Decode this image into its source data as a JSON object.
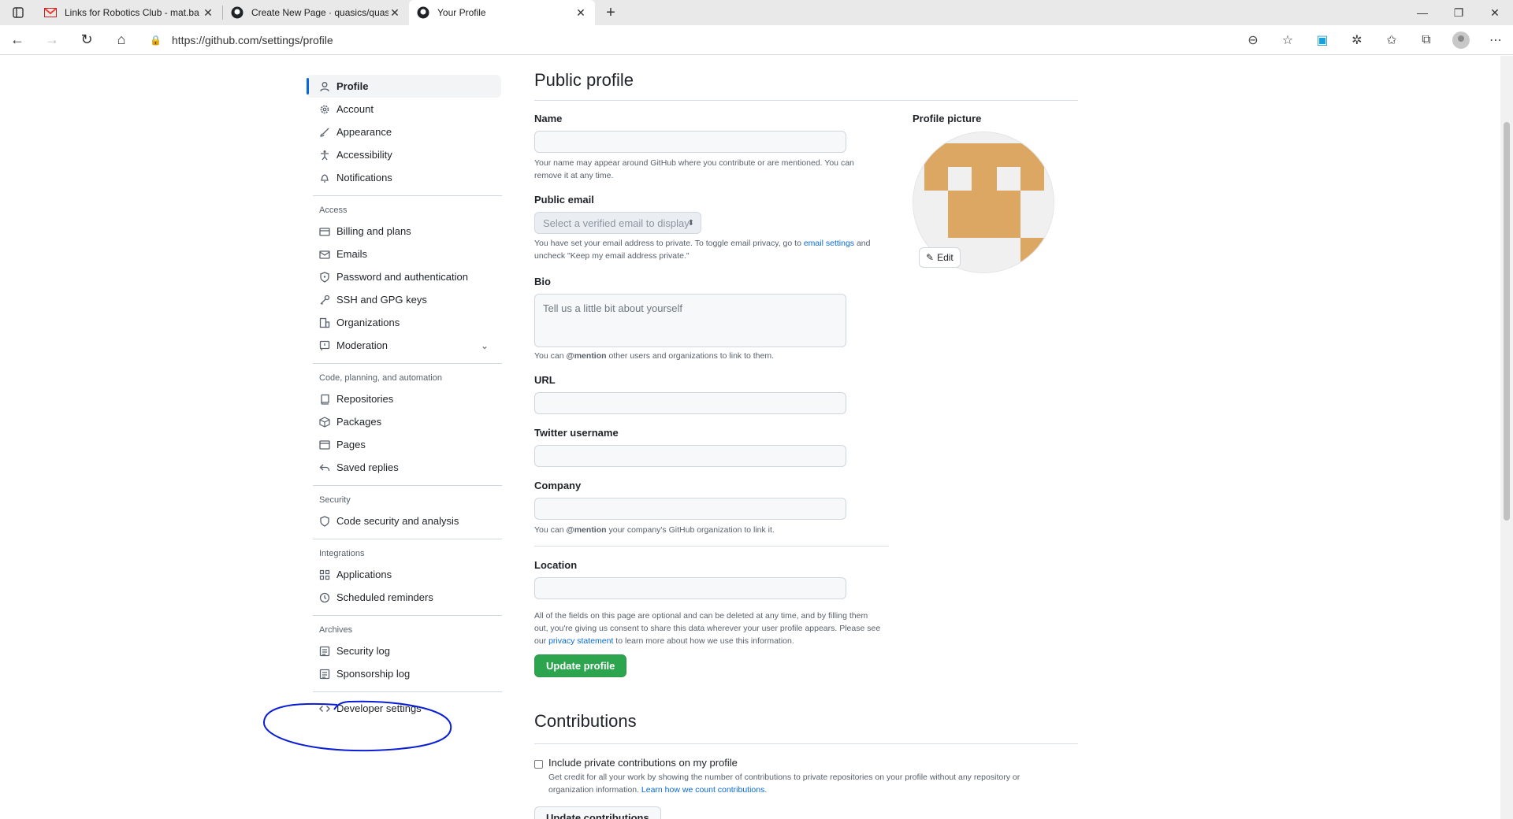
{
  "browser": {
    "tabs": [
      {
        "title": "Links for Robotics Club - mat.ba",
        "favicon": "gmail-icon",
        "active": false
      },
      {
        "title": "Create New Page · quasics/quasi",
        "favicon": "github-icon",
        "active": false
      },
      {
        "title": "Your Profile",
        "favicon": "github-icon",
        "active": true
      }
    ],
    "url": "https://github.com/settings/profile"
  },
  "sidebar": {
    "top": [
      {
        "label": "Profile",
        "icon": "person-icon",
        "selected": true
      },
      {
        "label": "Account",
        "icon": "gear-icon"
      },
      {
        "label": "Appearance",
        "icon": "paintbrush-icon"
      },
      {
        "label": "Accessibility",
        "icon": "accessibility-icon"
      },
      {
        "label": "Notifications",
        "icon": "bell-icon"
      }
    ],
    "access_heading": "Access",
    "access": [
      {
        "label": "Billing and plans",
        "icon": "credit-card-icon"
      },
      {
        "label": "Emails",
        "icon": "mail-icon"
      },
      {
        "label": "Password and authentication",
        "icon": "shield-lock-icon"
      },
      {
        "label": "SSH and GPG keys",
        "icon": "key-icon"
      },
      {
        "label": "Organizations",
        "icon": "organization-icon"
      },
      {
        "label": "Moderation",
        "icon": "report-icon"
      }
    ],
    "code_heading": "Code, planning, and automation",
    "code": [
      {
        "label": "Repositories",
        "icon": "repo-icon"
      },
      {
        "label": "Packages",
        "icon": "package-icon"
      },
      {
        "label": "Pages",
        "icon": "browser-icon"
      },
      {
        "label": "Saved replies",
        "icon": "reply-icon"
      }
    ],
    "security_heading": "Security",
    "security": [
      {
        "label": "Code security and analysis",
        "icon": "shield-icon"
      }
    ],
    "integrations_heading": "Integrations",
    "integrations": [
      {
        "label": "Applications",
        "icon": "apps-icon"
      },
      {
        "label": "Scheduled reminders",
        "icon": "clock-icon"
      }
    ],
    "archives_heading": "Archives",
    "archives": [
      {
        "label": "Security log",
        "icon": "log-icon"
      },
      {
        "label": "Sponsorship log",
        "icon": "log-icon"
      }
    ],
    "developer": {
      "label": "Developer settings",
      "icon": "code-icon"
    }
  },
  "profile": {
    "title": "Public profile",
    "name_label": "Name",
    "name_note_1": "Your name may appear around GitHub where you contribute or are mentioned. You can",
    "name_note_2": "remove it at any time.",
    "email_label": "Public email",
    "email_select": "Select a verified email to display",
    "email_note_1a": "You have set your email address to private. To toggle email privacy, go to ",
    "email_note_link": "email settings",
    "email_note_1b": " and",
    "email_note_2": "uncheck \"Keep my email address private.\"",
    "bio_label": "Bio",
    "bio_placeholder": "Tell us a little bit about yourself",
    "bio_note_a": "You can ",
    "bio_note_mention": "@mention",
    "bio_note_b": " other users and organizations to link to them.",
    "url_label": "URL",
    "twitter_label": "Twitter username",
    "company_label": "Company",
    "company_note_a": "You can ",
    "company_note_mention": "@mention",
    "company_note_b": " your company's GitHub organization to link it.",
    "location_label": "Location",
    "consent_1": "All of the fields on this page are optional and can be deleted at any time, and by filling them",
    "consent_2": "out, you're giving us consent to share this data wherever your user profile appears. Please see",
    "consent_3a": "our ",
    "consent_link": "privacy statement",
    "consent_3b": " to learn more about how we use this information.",
    "update_button": "Update profile",
    "picture_label": "Profile picture",
    "edit_button": "Edit"
  },
  "contributions": {
    "title": "Contributions",
    "checkbox_label": "Include private contributions on my profile",
    "note_1": "Get credit for all your work by showing the number of contributions to private repositories on your profile without any repository or",
    "note_2a": "organization information. ",
    "note_link": "Learn how we count contributions.",
    "update_button": "Update contributions"
  },
  "colors": {
    "accent": "#0969da",
    "primary_button": "#2da44e",
    "avatar": "#dba763",
    "annotation": "#0a1ed6"
  }
}
